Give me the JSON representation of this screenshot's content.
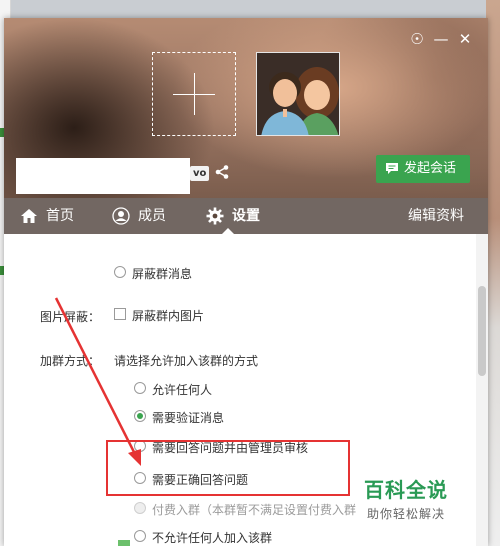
{
  "window": {
    "controls": {
      "skin": "☉",
      "minimize": "—",
      "close": "✕"
    }
  },
  "header": {
    "group_tag": "vo",
    "chat_button": "发起会话"
  },
  "tabs": [
    {
      "label": "首页",
      "icon": "home-icon"
    },
    {
      "label": "成员",
      "icon": "user-icon"
    },
    {
      "label": "设置",
      "icon": "gear-icon",
      "active": true
    }
  ],
  "edit_profile": "编辑资料",
  "settings": {
    "block_message_option": "屏蔽群消息",
    "image_block_label": "图片屏蔽：",
    "image_block_option": "屏蔽群内图片",
    "join_method_label": "加群方式：",
    "join_method_desc": "请选择允许加入该群的方式",
    "join_options": [
      {
        "label": "允许任何人",
        "selected": false,
        "disabled": false
      },
      {
        "label": "需要验证消息",
        "selected": true,
        "disabled": false
      },
      {
        "label": "需要回答问题并由管理员审核",
        "selected": false,
        "disabled": false
      },
      {
        "label": "需要正确回答问题",
        "selected": false,
        "disabled": false
      },
      {
        "label": "付费入群（本群暂不满足设置付费入群",
        "selected": false,
        "disabled": true
      },
      {
        "label": "不允许任何人加入该群",
        "selected": false,
        "disabled": false
      }
    ]
  },
  "watermark": {
    "title": "百科全说",
    "subtitle": "助你轻松解决"
  },
  "colors": {
    "accent_green": "#3aa44f",
    "annotation_red": "#e53333"
  }
}
